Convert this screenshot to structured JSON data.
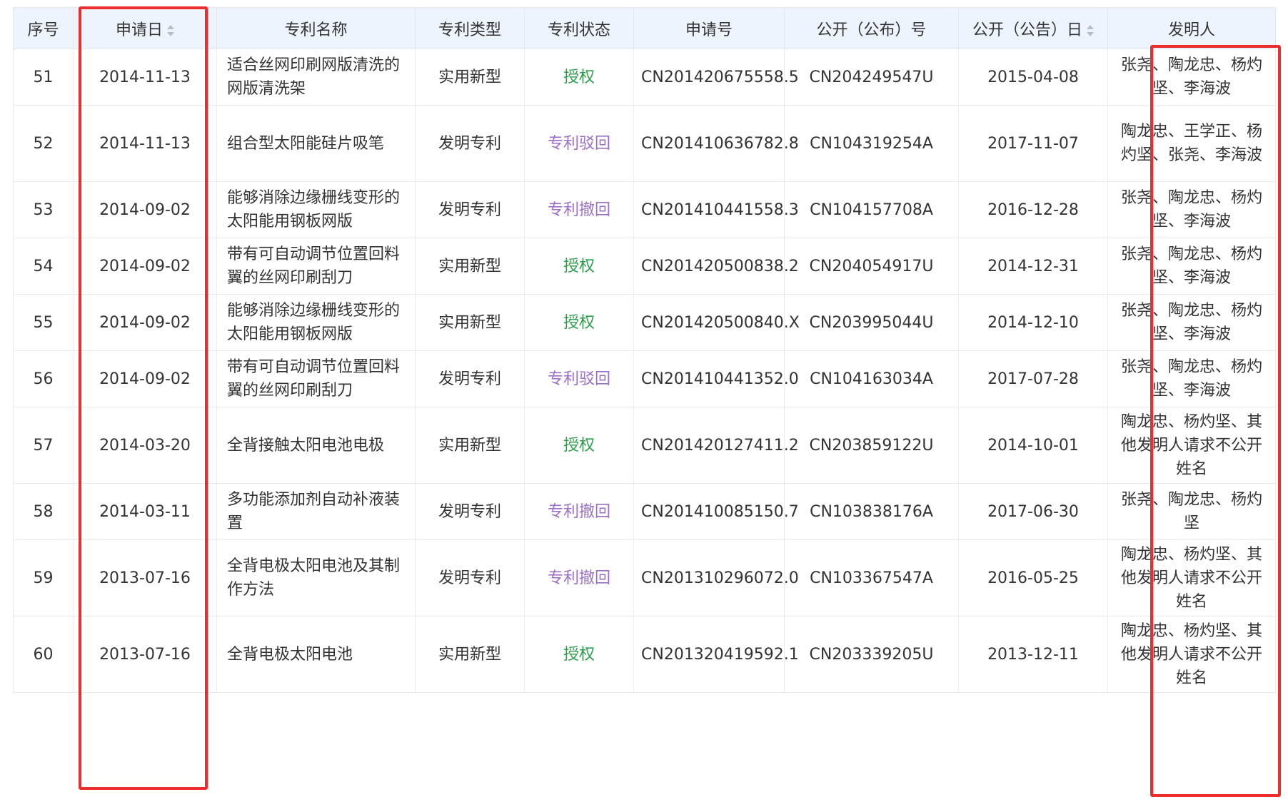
{
  "columns": {
    "seq": "序号",
    "apply_date": "申请日",
    "name": "专利名称",
    "type": "专利类型",
    "status": "专利状态",
    "apply_no": "申请号",
    "pub_no": "公开（公布）号",
    "pub_date": "公开（公告）日",
    "inventor": "发明人"
  },
  "rows": [
    {
      "seq": "51",
      "apply_date": "2014-11-13",
      "name": "适合丝网印刷网版清洗的网版清洗架",
      "type": "实用新型",
      "status": "授权",
      "apply_no": "CN201420675558.5",
      "pub_no": "CN204249547U",
      "pub_date": "2015-04-08",
      "inventor": "张尧、陶龙忠、杨灼坚、李海波"
    },
    {
      "seq": "52",
      "apply_date": "2014-11-13",
      "name": "组合型太阳能硅片吸笔",
      "type": "发明专利",
      "status": "专利驳回",
      "apply_no": "CN201410636782.8",
      "pub_no": "CN104319254A",
      "pub_date": "2017-11-07",
      "inventor": "陶龙忠、王学正、杨灼坚、张尧、李海波"
    },
    {
      "seq": "53",
      "apply_date": "2014-09-02",
      "name": "能够消除边缘栅线变形的太阳能用钢板网版",
      "type": "发明专利",
      "status": "专利撤回",
      "apply_no": "CN201410441558.3",
      "pub_no": "CN104157708A",
      "pub_date": "2016-12-28",
      "inventor": "张尧、陶龙忠、杨灼坚、李海波"
    },
    {
      "seq": "54",
      "apply_date": "2014-09-02",
      "name": "带有可自动调节位置回料翼的丝网印刷刮刀",
      "type": "实用新型",
      "status": "授权",
      "apply_no": "CN201420500838.2",
      "pub_no": "CN204054917U",
      "pub_date": "2014-12-31",
      "inventor": "张尧、陶龙忠、杨灼坚、李海波"
    },
    {
      "seq": "55",
      "apply_date": "2014-09-02",
      "name": "能够消除边缘栅线变形的太阳能用钢板网版",
      "type": "实用新型",
      "status": "授权",
      "apply_no": "CN201420500840.X",
      "pub_no": "CN203995044U",
      "pub_date": "2014-12-10",
      "inventor": "张尧、陶龙忠、杨灼坚、李海波"
    },
    {
      "seq": "56",
      "apply_date": "2014-09-02",
      "name": "带有可自动调节位置回料翼的丝网印刷刮刀",
      "type": "发明专利",
      "status": "专利驳回",
      "apply_no": "CN201410441352.0",
      "pub_no": "CN104163034A",
      "pub_date": "2017-07-28",
      "inventor": "张尧、陶龙忠、杨灼坚、李海波"
    },
    {
      "seq": "57",
      "apply_date": "2014-03-20",
      "name": "全背接触太阳电池电极",
      "type": "实用新型",
      "status": "授权",
      "apply_no": "CN201420127411.2",
      "pub_no": "CN203859122U",
      "pub_date": "2014-10-01",
      "inventor": "陶龙忠、杨灼坚、其他发明人请求不公开姓名"
    },
    {
      "seq": "58",
      "apply_date": "2014-03-11",
      "name": "多功能添加剂自动补液装置",
      "type": "发明专利",
      "status": "专利撤回",
      "apply_no": "CN201410085150.7",
      "pub_no": "CN103838176A",
      "pub_date": "2017-06-30",
      "inventor": "张尧、陶龙忠、杨灼坚"
    },
    {
      "seq": "59",
      "apply_date": "2013-07-16",
      "name": "全背电极太阳电池及其制作方法",
      "type": "发明专利",
      "status": "专利撤回",
      "apply_no": "CN201310296072.0",
      "pub_no": "CN103367547A",
      "pub_date": "2016-05-25",
      "inventor": "陶龙忠、杨灼坚、其他发明人请求不公开姓名"
    },
    {
      "seq": "60",
      "apply_date": "2013-07-16",
      "name": "全背电极太阳电池",
      "type": "实用新型",
      "status": "授权",
      "apply_no": "CN201320419592.1",
      "pub_no": "CN203339205U",
      "pub_date": "2013-12-11",
      "inventor": "陶龙忠、杨灼坚、其他发明人请求不公开姓名"
    }
  ],
  "colors": {
    "granted": "#2e9e4c",
    "rejected_withdrawn": "#9b6fc8",
    "highlight": "#ec2d2d",
    "header_bg": "#eef4fd"
  }
}
